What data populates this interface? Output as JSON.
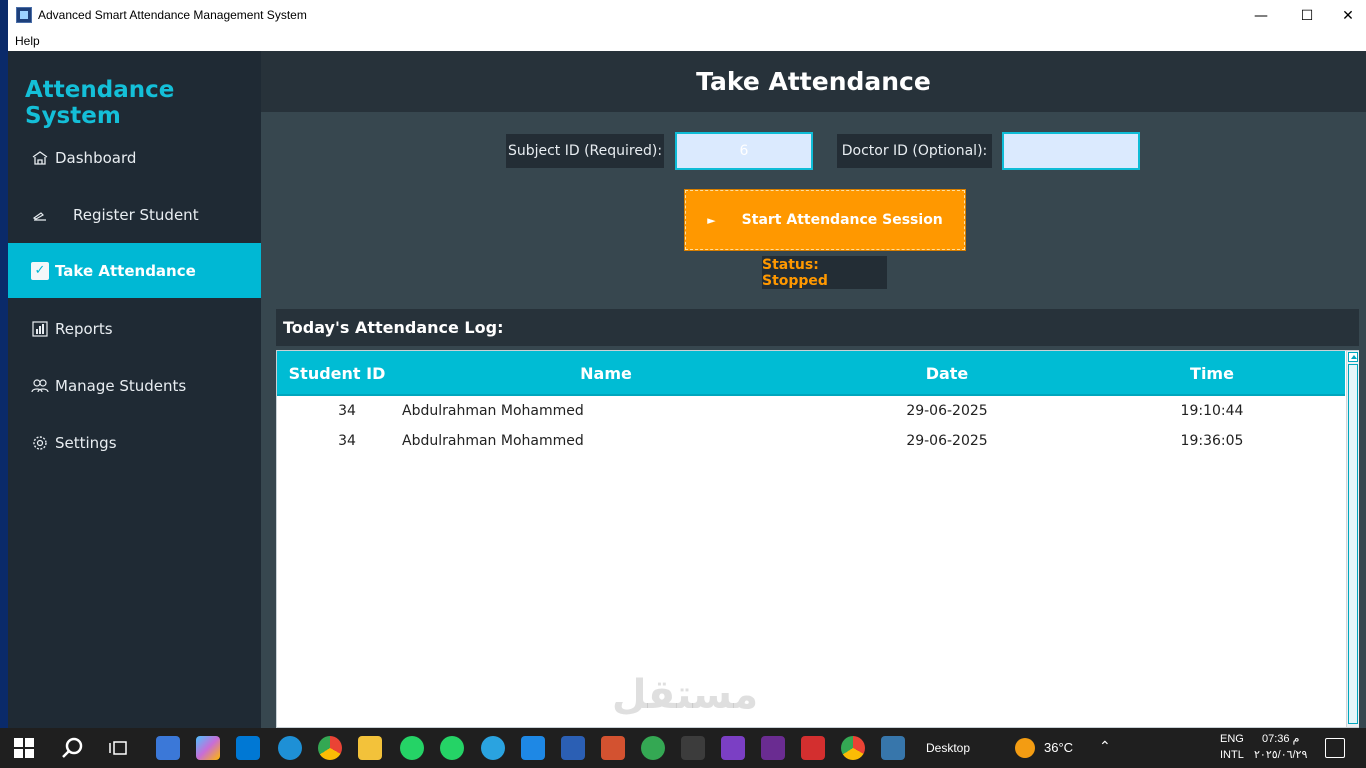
{
  "window": {
    "title": "Advanced Smart Attendance Management System",
    "menu": [
      "Help"
    ]
  },
  "sidebar": {
    "brand": "Attendance System",
    "items": [
      {
        "label": "Dashboard",
        "icon": "home-icon"
      },
      {
        "label": "Register Student",
        "icon": "pen-icon"
      },
      {
        "label": "Take Attendance",
        "icon": "checkbox-icon",
        "active": true
      },
      {
        "label": "Reports",
        "icon": "bar-chart-icon"
      },
      {
        "label": "Manage Students",
        "icon": "users-icon"
      },
      {
        "label": "Settings",
        "icon": "gear-icon"
      }
    ]
  },
  "main": {
    "title": "Take Attendance",
    "subject_label": "Subject ID (Required):",
    "subject_value": "6",
    "doctor_label": "Doctor ID (Optional):",
    "doctor_value": "",
    "start_button": "Start Attendance Session",
    "status": "Status: Stopped",
    "log_title": "Today's Attendance Log:",
    "table": {
      "headers": [
        "Student ID",
        "Name",
        "Date",
        "Time"
      ],
      "rows": [
        [
          "34",
          "Abdulrahman Mohammed",
          "29-06-2025",
          "19:10:44"
        ],
        [
          "34",
          "Abdulrahman Mohammed",
          "29-06-2025",
          "19:36:05"
        ]
      ]
    }
  },
  "colors": {
    "accent": "#00bcd4",
    "button": "#ff9800",
    "sidebar": "#1f2a34",
    "main_bg": "#37474f"
  },
  "watermark": "مستقل",
  "taskbar": {
    "desktop_label": "Desktop",
    "weather": "36°C",
    "lang_1": "ENG",
    "lang_2": "INTL",
    "time": "07:36 م",
    "date": "٢٠٢٥/٠٦/٢٩"
  }
}
